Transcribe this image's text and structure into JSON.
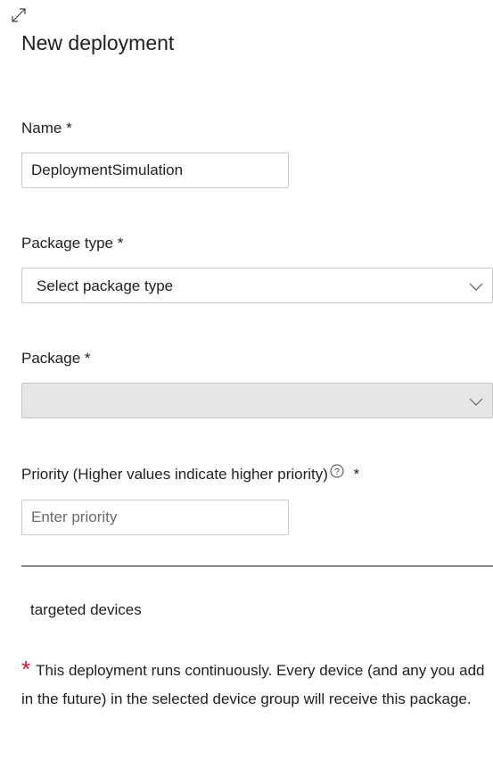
{
  "form": {
    "title": "New deployment",
    "name": {
      "label": "Name *",
      "value": "DeploymentSimulation"
    },
    "package_type": {
      "label": "Package type *",
      "selected": "Select package type"
    },
    "package": {
      "label": "Package *",
      "selected": "",
      "disabled": true
    },
    "priority": {
      "label": "Priority (Higher values indicate higher priority)",
      "required_marker": "*",
      "placeholder": "Enter priority",
      "value": ""
    },
    "targeted_devices_label": "targeted devices",
    "note": {
      "marker": "*",
      "text": "This deployment runs continuously. Every device (and any you add in the future) in the selected device group will receive this package."
    }
  },
  "icons": {
    "expand": "expand-icon",
    "chevron": "chevron-down-icon",
    "help": "help-circle-icon"
  },
  "colors": {
    "required_marker": "#e81123",
    "disabled_background": "#e6e6e6",
    "input_border": "#c8c8c8"
  }
}
